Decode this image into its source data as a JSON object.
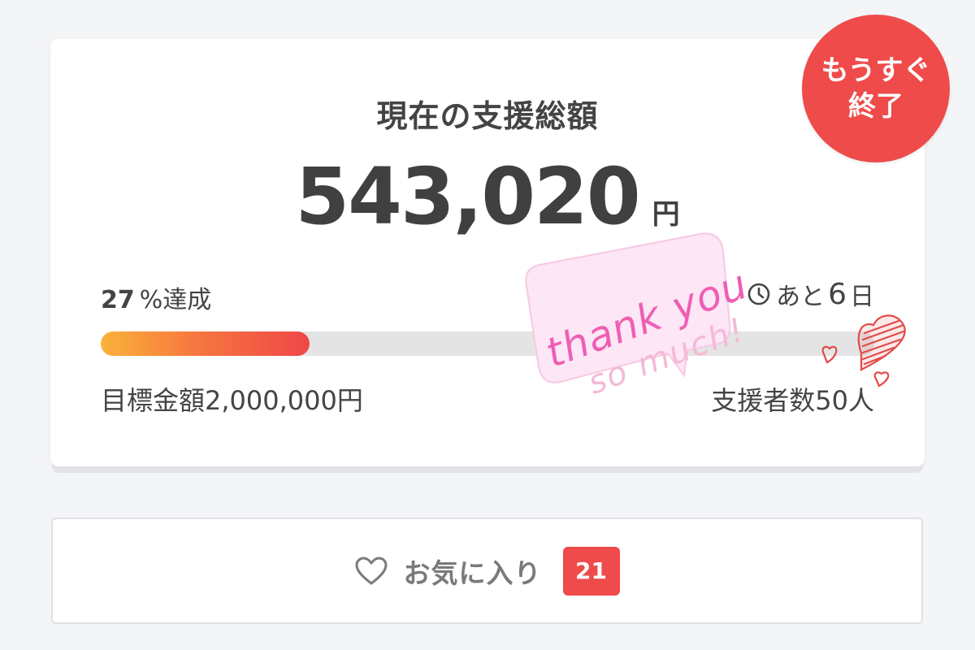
{
  "funding": {
    "title": "現在の支援総額",
    "amount": "543,020",
    "amount_unit": "円",
    "badge": "もうすぐ\n終了",
    "progress": {
      "percent_value": "27",
      "percent_symbol": "%",
      "percent_label": "達成",
      "fraction": 0.27
    },
    "remaining": {
      "prefix": "あと",
      "days": "6",
      "unit": "日"
    },
    "goal_label": "目標金額2,000,000円",
    "backers_label": "支援者数50人"
  },
  "sticker": {
    "line1": "thank you",
    "line2": "so much!",
    "fill": "#fde6f5",
    "pink_text": "#ee5fb4",
    "pale_text": "#f4b9d6"
  },
  "favorite": {
    "label": "お気に入り",
    "count": "21"
  },
  "icons": {
    "clock": "clock-icon",
    "heart_outline": "heart-outline-icon",
    "hearts_doodle": "hearts-doodle-icon"
  },
  "colors": {
    "accent_red": "#ee4b4a",
    "progress_start": "#fbb23a",
    "progress_end": "#ef4747",
    "track": "#e4e4e4"
  }
}
